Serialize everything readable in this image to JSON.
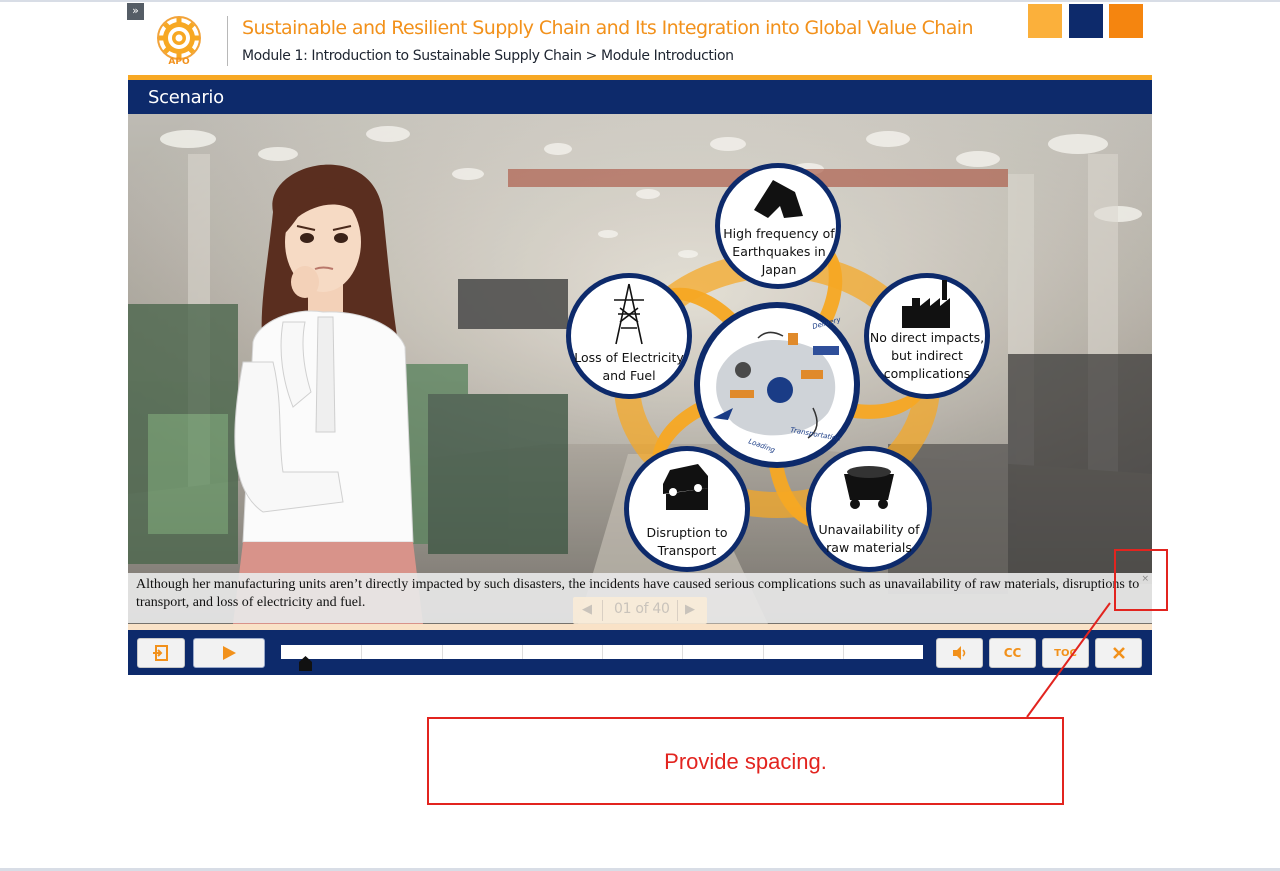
{
  "header": {
    "expand_icon": "»",
    "logo_text": "APO",
    "course_title": "Sustainable and Resilient Supply Chain and Its Integration into Global Value Chain",
    "breadcrumb": "Module 1: Introduction to Sustainable Supply Chain > Module Introduction",
    "accent_colors": [
      "#fbb03b",
      "#0d2a6b",
      "#f5850f"
    ]
  },
  "slide": {
    "section_title": "Scenario",
    "diagram": {
      "center_labels": [
        "Delivery",
        "Loading",
        "Transportation"
      ],
      "nodes": [
        {
          "label_lines": [
            "High frequency of",
            "Earthquakes in",
            "Japan"
          ],
          "icon": "collapsed-house-icon"
        },
        {
          "label_lines": [
            "No direct impacts,",
            "but indirect",
            "complications"
          ],
          "icon": "factory-icon"
        },
        {
          "label_lines": [
            "Unavailability of",
            "raw materials"
          ],
          "icon": "mine-cart-icon"
        },
        {
          "label_lines": [
            "Disruption to",
            "Transport"
          ],
          "icon": "crashed-car-icon"
        },
        {
          "label_lines": [
            "Loss of Electricity",
            "and Fuel"
          ],
          "icon": "power-tower-icon"
        }
      ]
    },
    "caption": "Although her manufacturing units aren’t directly impacted by such disasters, the incidents have caused serious complications such as unavailability of raw materials, disruptions to transport, and loss of electricity and fuel.",
    "caption_close": "×",
    "pager": {
      "prev": "◀",
      "label": "01 of 40",
      "next": "▶"
    }
  },
  "controls": {
    "exit_icon": "exit-icon",
    "play_icon": "play-icon",
    "progress_fraction": 0.03,
    "volume_icon": "speaker-icon",
    "cc_label": "CC",
    "toc_label": "TOC",
    "close_icon": "close-icon"
  },
  "review_annotation": {
    "comment": "Provide spacing.",
    "color": "#e2241f"
  }
}
